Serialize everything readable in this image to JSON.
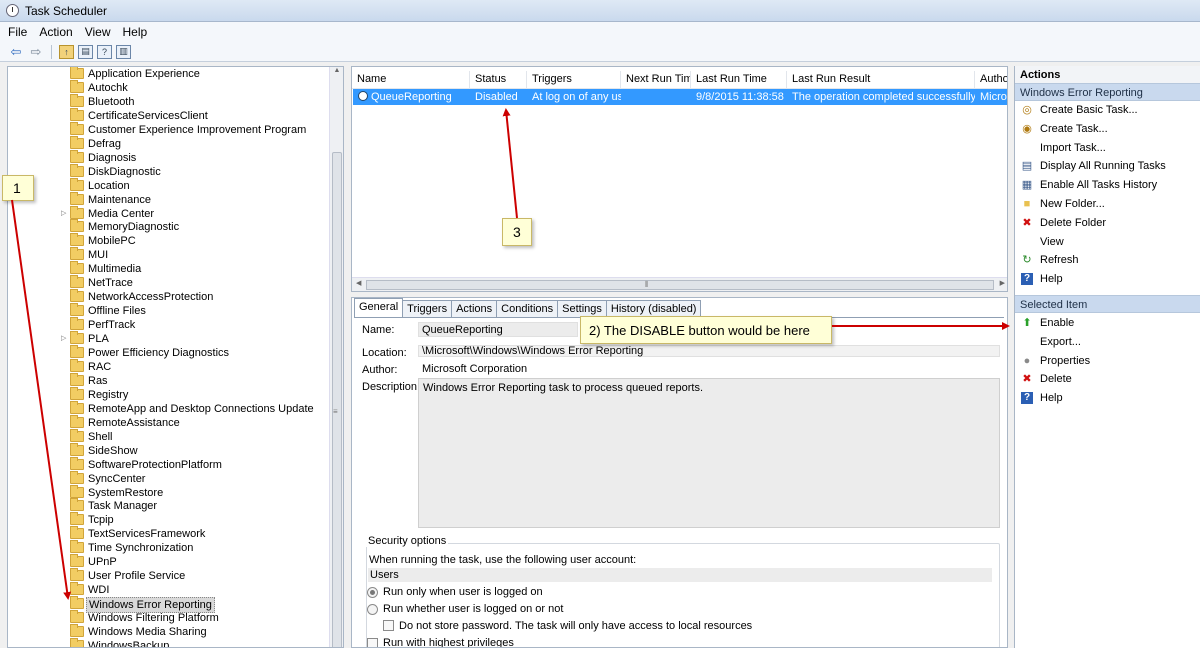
{
  "window": {
    "title": "Task Scheduler"
  },
  "menu": [
    "File",
    "Action",
    "View",
    "Help"
  ],
  "tree": {
    "items": [
      {
        "label": "Application Experience"
      },
      {
        "label": "Autochk"
      },
      {
        "label": "Bluetooth"
      },
      {
        "label": "CertificateServicesClient"
      },
      {
        "label": "Customer Experience Improvement Program"
      },
      {
        "label": "Defrag"
      },
      {
        "label": "Diagnosis"
      },
      {
        "label": "DiskDiagnostic"
      },
      {
        "label": "Location"
      },
      {
        "label": "Maintenance"
      },
      {
        "label": "Media Center",
        "expandable": true
      },
      {
        "label": "MemoryDiagnostic"
      },
      {
        "label": "MobilePC"
      },
      {
        "label": "MUI"
      },
      {
        "label": "Multimedia"
      },
      {
        "label": "NetTrace"
      },
      {
        "label": "NetworkAccessProtection"
      },
      {
        "label": "Offline Files"
      },
      {
        "label": "PerfTrack"
      },
      {
        "label": "PLA",
        "expandable": true
      },
      {
        "label": "Power Efficiency Diagnostics"
      },
      {
        "label": "RAC"
      },
      {
        "label": "Ras"
      },
      {
        "label": "Registry"
      },
      {
        "label": "RemoteApp and Desktop Connections Update"
      },
      {
        "label": "RemoteAssistance"
      },
      {
        "label": "Shell"
      },
      {
        "label": "SideShow"
      },
      {
        "label": "SoftwareProtectionPlatform"
      },
      {
        "label": "SyncCenter"
      },
      {
        "label": "SystemRestore"
      },
      {
        "label": "Task Manager"
      },
      {
        "label": "Tcpip"
      },
      {
        "label": "TextServicesFramework"
      },
      {
        "label": "Time Synchronization"
      },
      {
        "label": "UPnP"
      },
      {
        "label": "User Profile Service"
      },
      {
        "label": "WDI"
      },
      {
        "label": "Windows Error Reporting",
        "selected": true
      },
      {
        "label": "Windows Filtering Platform"
      },
      {
        "label": "Windows Media Sharing"
      },
      {
        "label": "WindowsBackup"
      }
    ]
  },
  "task_list": {
    "columns": [
      "Name",
      "Status",
      "Triggers",
      "Next Run Time",
      "Last Run Time",
      "Last Run Result",
      "Autho"
    ],
    "rows": [
      {
        "name": "QueueReporting",
        "status": "Disabled",
        "triggers": "At log on of any user",
        "next_run": "",
        "last_run": "9/8/2015 11:38:58 PM",
        "last_result": "The operation completed successfully. (0x0)",
        "author": "Micros"
      }
    ]
  },
  "details": {
    "tabs": [
      "General",
      "Triggers",
      "Actions",
      "Conditions",
      "Settings",
      "History (disabled)"
    ],
    "name_label": "Name:",
    "name_value": "QueueReporting",
    "location_label": "Location:",
    "location_value": "\\Microsoft\\Windows\\Windows Error Reporting",
    "author_label": "Author:",
    "author_value": "Microsoft Corporation",
    "description_label": "Description:",
    "description_value": "Windows Error Reporting task to process queued reports.",
    "security_title": "Security options",
    "security_text": "When running the task, use the following user account:",
    "security_account": "Users",
    "opt_logged_on": "Run only when user is logged on",
    "opt_whether": "Run whether user is logged on or not",
    "opt_no_password": "Do not store password.  The task will only have access to local resources",
    "opt_highest": "Run with highest privileges"
  },
  "actions": {
    "header": "Actions",
    "folder_section": "Windows Error Reporting",
    "folder_items": [
      {
        "label": "Create Basic Task...",
        "icon": "create-basic-task-icon"
      },
      {
        "label": "Create Task...",
        "icon": "create-task-icon"
      },
      {
        "label": "Import Task...",
        "icon": ""
      },
      {
        "label": "Display All Running Tasks",
        "icon": "running-tasks-icon"
      },
      {
        "label": "Enable All Tasks History",
        "icon": "history-icon"
      },
      {
        "label": "New Folder...",
        "icon": "folder-icon"
      },
      {
        "label": "Delete Folder",
        "icon": "delete-icon"
      },
      {
        "label": "View",
        "icon": ""
      },
      {
        "label": "Refresh",
        "icon": "refresh-icon"
      },
      {
        "label": "Help",
        "icon": "help-icon"
      }
    ],
    "item_section": "Selected Item",
    "item_items": [
      {
        "label": "Enable",
        "icon": "enable-arrow-icon"
      },
      {
        "label": "Export...",
        "icon": ""
      },
      {
        "label": "Properties",
        "icon": "properties-icon"
      },
      {
        "label": "Delete",
        "icon": "delete-icon"
      },
      {
        "label": "Help",
        "icon": "help-icon"
      }
    ]
  },
  "annotations": {
    "callout1": "1",
    "callout2": "2) The DISABLE button would be here",
    "callout3": "3",
    "arrow_color": "#cc0000"
  },
  "colors": {
    "selection": "#3399ff",
    "section_header": "#c9d9ee",
    "callout_bg": "#ffffd7"
  }
}
